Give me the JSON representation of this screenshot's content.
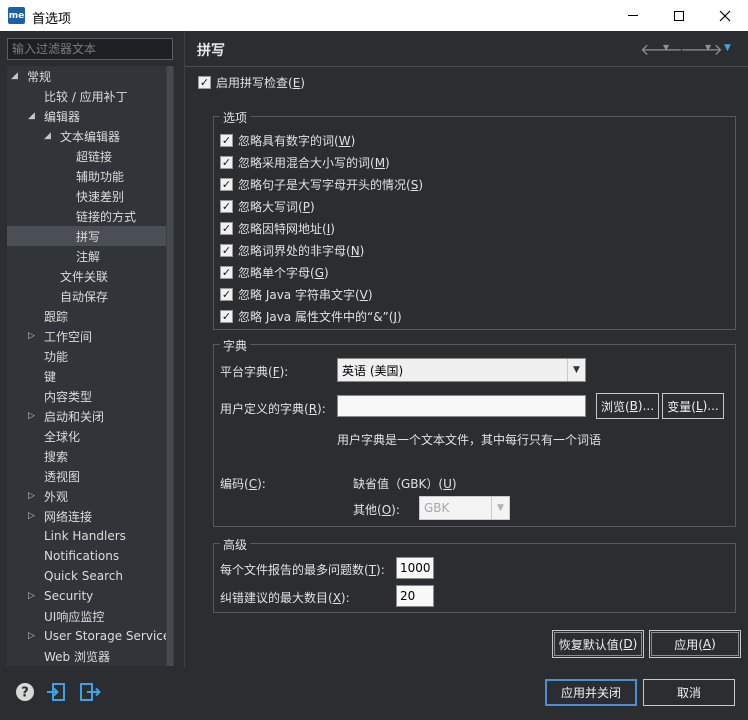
{
  "window": {
    "title": "首选项",
    "logo": "me"
  },
  "filter": {
    "placeholder": "输入过滤器文本"
  },
  "tree": [
    {
      "label": "常规",
      "indent": 0,
      "twisty": "open"
    },
    {
      "label": "比较 / 应用补丁",
      "indent": 1,
      "twisty": ""
    },
    {
      "label": "编辑器",
      "indent": 1,
      "twisty": "open"
    },
    {
      "label": "文本编辑器",
      "indent": 2,
      "twisty": "open"
    },
    {
      "label": "超链接",
      "indent": 3,
      "twisty": ""
    },
    {
      "label": "辅助功能",
      "indent": 3,
      "twisty": ""
    },
    {
      "label": "快速差别",
      "indent": 3,
      "twisty": ""
    },
    {
      "label": "链接的方式",
      "indent": 3,
      "twisty": ""
    },
    {
      "label": "拼写",
      "indent": 3,
      "twisty": "",
      "selected": true
    },
    {
      "label": "注解",
      "indent": 3,
      "twisty": ""
    },
    {
      "label": "文件关联",
      "indent": 2,
      "twisty": ""
    },
    {
      "label": "自动保存",
      "indent": 2,
      "twisty": ""
    },
    {
      "label": "跟踪",
      "indent": 1,
      "twisty": ""
    },
    {
      "label": "工作空间",
      "indent": 1,
      "twisty": "closed"
    },
    {
      "label": "功能",
      "indent": 1,
      "twisty": ""
    },
    {
      "label": "键",
      "indent": 1,
      "twisty": ""
    },
    {
      "label": "内容类型",
      "indent": 1,
      "twisty": ""
    },
    {
      "label": "启动和关闭",
      "indent": 1,
      "twisty": "closed"
    },
    {
      "label": "全球化",
      "indent": 1,
      "twisty": ""
    },
    {
      "label": "搜索",
      "indent": 1,
      "twisty": ""
    },
    {
      "label": "透视图",
      "indent": 1,
      "twisty": ""
    },
    {
      "label": "外观",
      "indent": 1,
      "twisty": "closed"
    },
    {
      "label": "网络连接",
      "indent": 1,
      "twisty": "closed"
    },
    {
      "label": "Link Handlers",
      "indent": 1,
      "twisty": ""
    },
    {
      "label": "Notifications",
      "indent": 1,
      "twisty": ""
    },
    {
      "label": "Quick Search",
      "indent": 1,
      "twisty": ""
    },
    {
      "label": "Security",
      "indent": 1,
      "twisty": "closed"
    },
    {
      "label": "UI响应监控",
      "indent": 1,
      "twisty": ""
    },
    {
      "label": "User Storage Service",
      "indent": 1,
      "twisty": "closed"
    },
    {
      "label": "Web 浏览器",
      "indent": 1,
      "twisty": ""
    }
  ],
  "page": {
    "title": "拼写",
    "enable_spell": {
      "label": "启用拼写检查(",
      "key": "E",
      "suffix": ")",
      "checked": true
    }
  },
  "options": {
    "title": "选项",
    "items": [
      {
        "label": "忽略具有数字的词(",
        "key": "W",
        "suffix": ")"
      },
      {
        "label": "忽略采用混合大小写的词(",
        "key": "M",
        "suffix": ")"
      },
      {
        "label": "忽略句子是大写字母开头的情况(",
        "key": "S",
        "suffix": ")"
      },
      {
        "label": "忽略大写词(",
        "key": "P",
        "suffix": ")"
      },
      {
        "label": "忽略因特网地址(",
        "key": "I",
        "suffix": ")"
      },
      {
        "label": "忽略词界处的非字母(",
        "key": "N",
        "suffix": ")"
      },
      {
        "label": "忽略单个字母(",
        "key": "G",
        "suffix": ")"
      },
      {
        "label": "忽略 Java 字符串文字(",
        "key": "V",
        "suffix": ")"
      },
      {
        "label": "忽略 Java 属性文件中的“&”(",
        "key": "J",
        "suffix": ")"
      }
    ]
  },
  "dictionary": {
    "title": "字典",
    "platform_label": "平台字典(",
    "platform_key": "F",
    "platform_suffix": "):",
    "platform_value": "英语 (美国)",
    "user_label": "用户定义的字典(",
    "user_key": "R",
    "user_suffix": "):",
    "user_value": "",
    "browse_label": "浏览(",
    "browse_key": "B",
    "browse_suffix": ")...",
    "variables_label": "变量(",
    "variables_key": "L",
    "variables_suffix": ")...",
    "hint": "用户字典是一个文本文件，其中每行只有一个词语",
    "encoding_label": "编码(",
    "encoding_key": "C",
    "encoding_suffix": "):",
    "default_label": "缺省值（GBK）(",
    "default_key": "U",
    "default_suffix": ")",
    "other_label": "其他(",
    "other_key": "O",
    "other_suffix": "):",
    "other_value": "GBK"
  },
  "advanced": {
    "title": "高级",
    "max_problems_label": "每个文件报告的最多问题数(",
    "max_problems_key": "T",
    "max_problems_suffix": "):",
    "max_problems_value": "1000",
    "max_suggestions_label": "纠错建议的最大数目(",
    "max_suggestions_key": "X",
    "max_suggestions_suffix": "):",
    "max_suggestions_value": "20"
  },
  "buttons": {
    "restore_label": "恢复默认值(",
    "restore_key": "D",
    "restore_suffix": ")",
    "apply_label": "应用(",
    "apply_key": "A",
    "apply_suffix": ")",
    "apply_close": "应用并关闭",
    "cancel": "取消"
  },
  "colors": {
    "accent": "#4a90d9",
    "icon_blue": "#3ea3e6"
  }
}
